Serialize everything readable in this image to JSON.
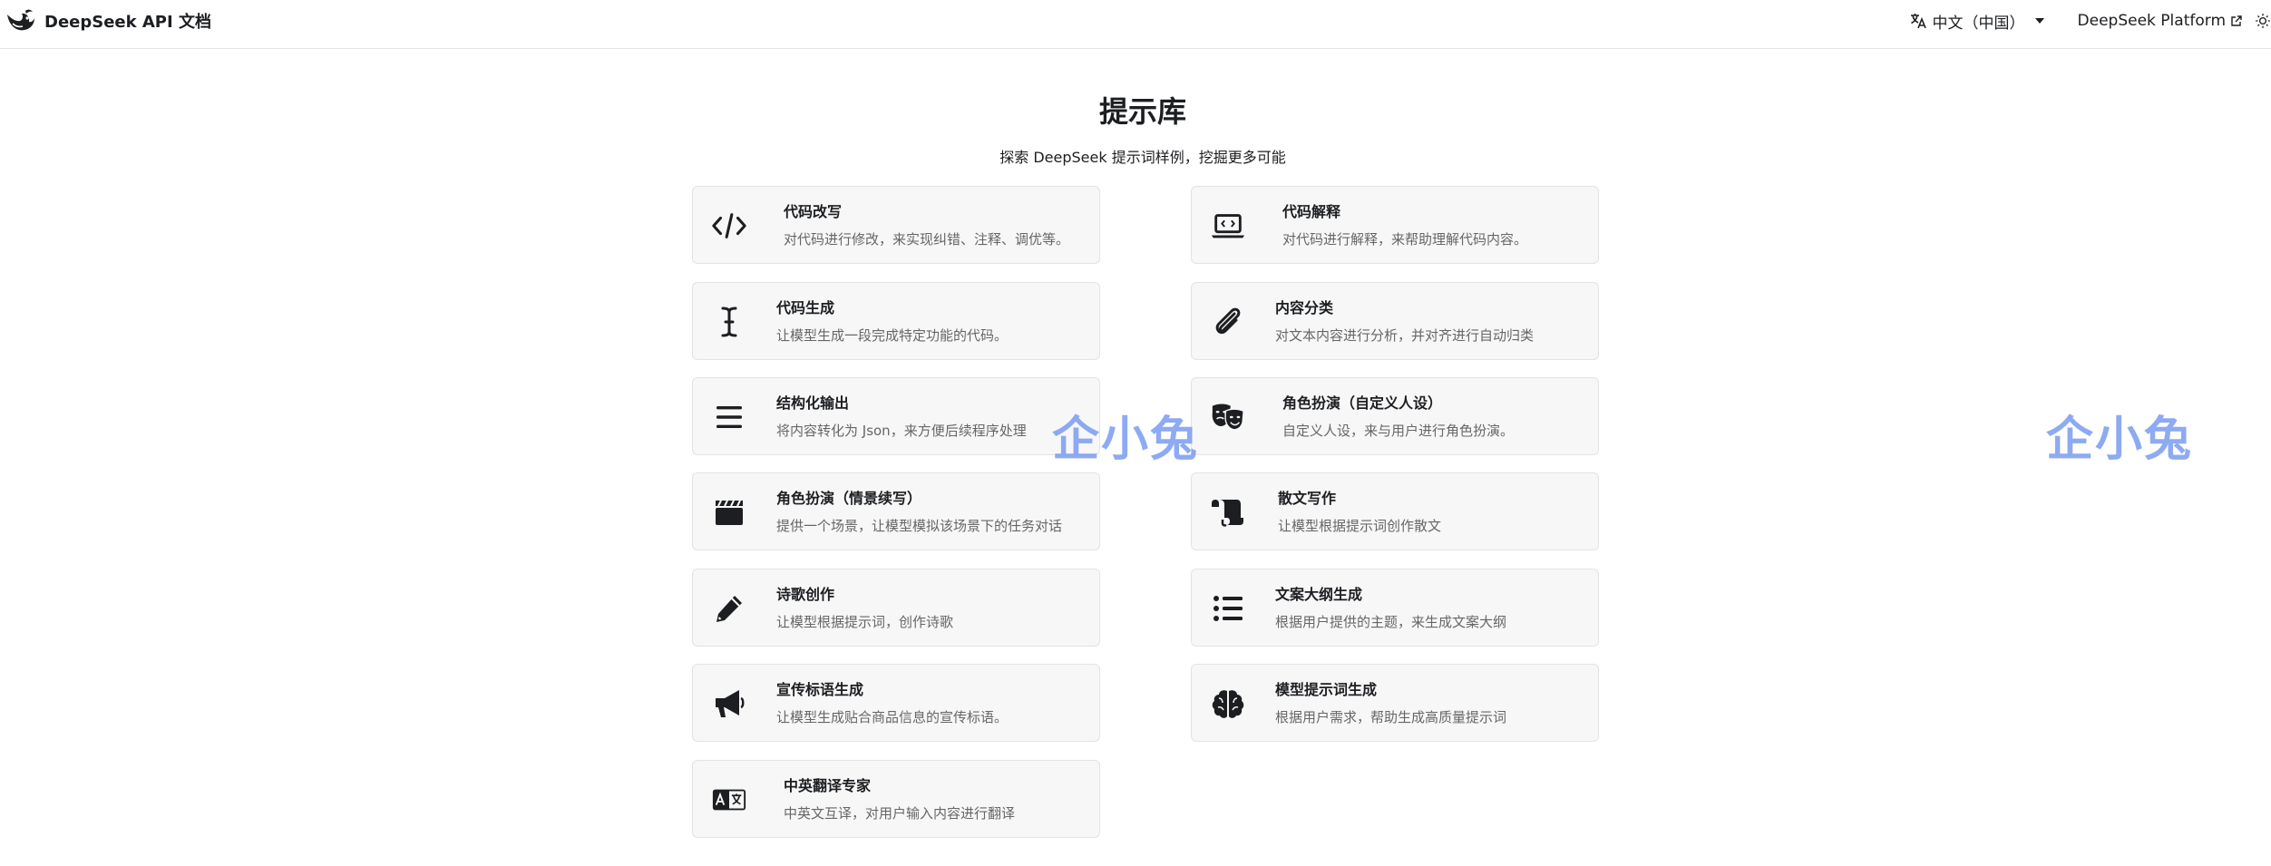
{
  "navbar": {
    "brand_title": "DeepSeek API 文档",
    "language": "中文（中国）",
    "platform_link": "DeepSeek Platform"
  },
  "header": {
    "title": "提示库",
    "subtitle": "探索 DeepSeek 提示词样例，挖掘更多可能"
  },
  "cards": [
    {
      "title": "代码改写",
      "desc": "对代码进行修改，来实现纠错、注释、调优等。",
      "icon": "code-icon"
    },
    {
      "title": "代码解释",
      "desc": "对代码进行解释，来帮助理解代码内容。",
      "icon": "laptop-code-icon"
    },
    {
      "title": "代码生成",
      "desc": "让模型生成一段完成特定功能的代码。",
      "icon": "text-cursor-icon"
    },
    {
      "title": "内容分类",
      "desc": "对文本内容进行分析，并对齐进行自动归类",
      "icon": "paperclip-icon"
    },
    {
      "title": "结构化输出",
      "desc": "将内容转化为 Json，来方便后续程序处理",
      "icon": "bars-icon"
    },
    {
      "title": "角色扮演（自定义人设）",
      "desc": "自定义人设，来与用户进行角色扮演。",
      "icon": "theater-masks-icon"
    },
    {
      "title": "角色扮演（情景续写）",
      "desc": "提供一个场景，让模型模拟该场景下的任务对话",
      "icon": "clapperboard-icon"
    },
    {
      "title": "散文写作",
      "desc": "让模型根据提示词创作散文",
      "icon": "scroll-icon"
    },
    {
      "title": "诗歌创作",
      "desc": "让模型根据提示词，创作诗歌",
      "icon": "pen-icon"
    },
    {
      "title": "文案大纲生成",
      "desc": "根据用户提供的主题，来生成文案大纲",
      "icon": "list-icon"
    },
    {
      "title": "宣传标语生成",
      "desc": "让模型生成贴合商品信息的宣传标语。",
      "icon": "bullhorn-icon"
    },
    {
      "title": "模型提示词生成",
      "desc": "根据用户需求，帮助生成高质量提示词",
      "icon": "brain-icon"
    },
    {
      "title": "中英翻译专家",
      "desc": "中英文互译，对用户输入内容进行翻译",
      "icon": "language-icon"
    }
  ],
  "watermark": "企小兔",
  "colors": {
    "card_background": "#f7f7f7",
    "card_border": "#e3e3e3",
    "text_primary": "#1c1e21",
    "text_secondary": "#666666",
    "watermark": "#7a9cf0"
  }
}
